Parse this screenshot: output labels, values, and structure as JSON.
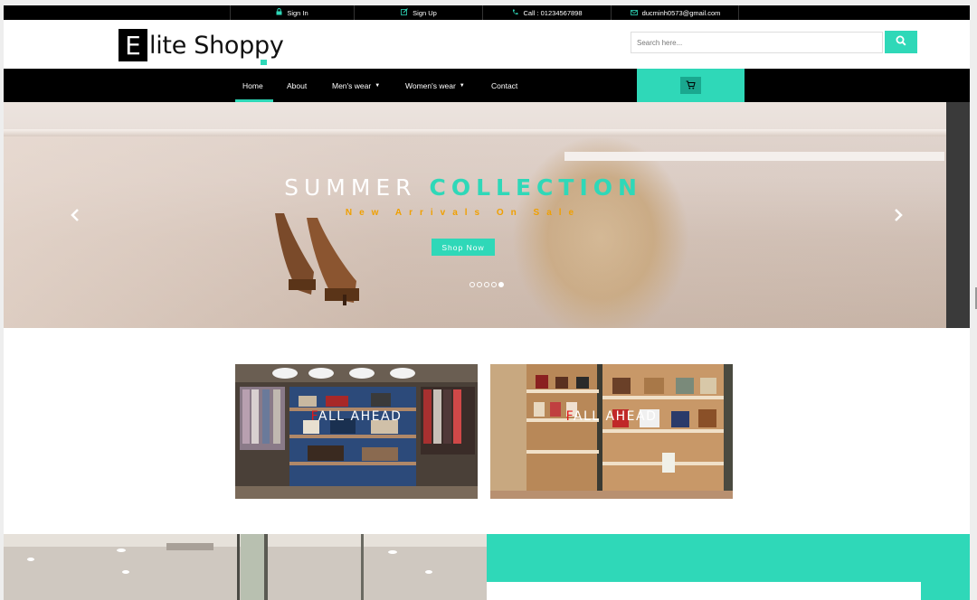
{
  "topbar": {
    "items": [
      {
        "icon": "lock-icon",
        "label": "Sign In"
      },
      {
        "icon": "edit-icon",
        "label": "Sign Up"
      },
      {
        "icon": "phone-icon",
        "label": "Call : 01234567898"
      },
      {
        "icon": "mail-icon",
        "label": "ducminh0573@gmail.com"
      }
    ]
  },
  "header": {
    "logo_letter": "E",
    "logo_rest": "lite Shoppy",
    "search_placeholder": "Search here..."
  },
  "nav": {
    "items": [
      "Home",
      "About",
      "Men's wear",
      "Women's wear",
      "Contact"
    ],
    "active": "Home"
  },
  "hero": {
    "title_main": "SUMMER ",
    "title_accent": "COLLECTION",
    "subtitle": "New Arrivals On Sale",
    "button": "Shop Now",
    "slide_count": 5,
    "active_slide": 5
  },
  "banners": [
    {
      "first_letter": "F",
      "rest": "ALL AHEAD"
    },
    {
      "first_letter": "F",
      "rest": "ALL AHEAD"
    }
  ],
  "colors": {
    "accent": "#2fd8b8",
    "dark": "#000000",
    "subtitle": "#f0a000",
    "banner_letter": "#e01818"
  }
}
